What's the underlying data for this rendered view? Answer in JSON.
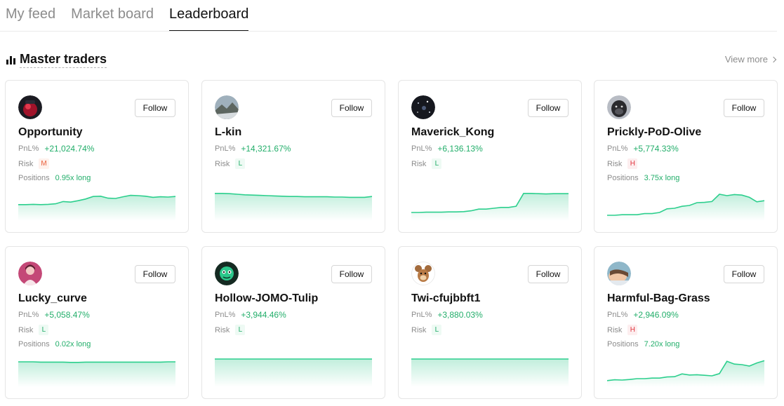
{
  "tabs": [
    {
      "label": "My feed",
      "active": false
    },
    {
      "label": "Market board",
      "active": false
    },
    {
      "label": "Leaderboard",
      "active": true
    }
  ],
  "section": {
    "title": "Master traders",
    "view_more": "View more"
  },
  "labels": {
    "follow": "Follow",
    "pnl": "PnL%",
    "risk": "Risk",
    "positions": "Positions"
  },
  "colors": {
    "accent_green": "#22ae6a",
    "risk_medium": "#e9603c",
    "risk_high": "#e0333c"
  },
  "traders": [
    {
      "name": "Opportunity",
      "pnl": "+21,024.74%",
      "risk": "M",
      "positions": "0.95x long",
      "avatar": "red-hooded-character-avatar",
      "trend": [
        0.38,
        0.38,
        0.39,
        0.38,
        0.39,
        0.41,
        0.49,
        0.47,
        0.52,
        0.58,
        0.67,
        0.68,
        0.61,
        0.6,
        0.66,
        0.71,
        0.7,
        0.68,
        0.64,
        0.66,
        0.65,
        0.67
      ]
    },
    {
      "name": "L-kin",
      "pnl": "+14,321.67%",
      "risk": "L",
      "positions": "",
      "avatar": "landscape-photo-avatar",
      "trend": [
        0.78,
        0.78,
        0.77,
        0.75,
        0.73,
        0.72,
        0.71,
        0.7,
        0.69,
        0.68,
        0.67,
        0.67,
        0.66,
        0.66,
        0.66,
        0.66,
        0.65,
        0.65,
        0.64,
        0.64,
        0.64,
        0.67
      ]
    },
    {
      "name": "Maverick_Kong",
      "pnl": "+6,136.13%",
      "risk": "L",
      "positions": "",
      "avatar": "galaxy-avatar",
      "trend": [
        0.1,
        0.1,
        0.11,
        0.11,
        0.11,
        0.12,
        0.12,
        0.13,
        0.16,
        0.22,
        0.22,
        0.25,
        0.28,
        0.28,
        0.32,
        0.78,
        0.78,
        0.77,
        0.76,
        0.77,
        0.77,
        0.77
      ]
    },
    {
      "name": "Prickly-PoD-Olive",
      "pnl": "+5,774.33%",
      "risk": "H",
      "positions": "3.75x long",
      "avatar": "gorilla-avatar",
      "trend": [
        0.0,
        0.0,
        0.02,
        0.02,
        0.02,
        0.06,
        0.06,
        0.1,
        0.23,
        0.25,
        0.32,
        0.35,
        0.45,
        0.46,
        0.49,
        0.75,
        0.7,
        0.74,
        0.72,
        0.64,
        0.48,
        0.52
      ]
    },
    {
      "name": "Lucky_curve",
      "pnl": "+5,058.47%",
      "risk": "L",
      "positions": "0.02x long",
      "avatar": "pink-portrait-avatar",
      "trend": [
        0.7,
        0.7,
        0.7,
        0.69,
        0.69,
        0.69,
        0.69,
        0.68,
        0.68,
        0.69,
        0.69,
        0.69,
        0.69,
        0.69,
        0.69,
        0.69,
        0.69,
        0.69,
        0.69,
        0.69,
        0.7,
        0.7
      ]
    },
    {
      "name": "Hollow-JOMO-Tulip",
      "pnl": "+3,944.46%",
      "risk": "L",
      "positions": "",
      "avatar": "neon-face-avatar",
      "trend": [
        0.8,
        0.8,
        0.8,
        0.8,
        0.8,
        0.8,
        0.8,
        0.8,
        0.8,
        0.8,
        0.8,
        0.8,
        0.8,
        0.8,
        0.8,
        0.8,
        0.8,
        0.8,
        0.8,
        0.8,
        0.8,
        0.8
      ]
    },
    {
      "name": "Twi-cfujbbft1",
      "pnl": "+3,880.03%",
      "risk": "L",
      "positions": "",
      "avatar": "cartoon-mouse-avatar",
      "trend": [
        0.8,
        0.8,
        0.8,
        0.8,
        0.8,
        0.8,
        0.8,
        0.8,
        0.8,
        0.8,
        0.8,
        0.8,
        0.8,
        0.8,
        0.8,
        0.8,
        0.8,
        0.8,
        0.8,
        0.8,
        0.8,
        0.8
      ]
    },
    {
      "name": "Harmful-Bag-Grass",
      "pnl": "+2,946.09%",
      "risk": "H",
      "positions": "7.20x long",
      "avatar": "sleeping-person-avatar",
      "trend": [
        0.03,
        0.06,
        0.05,
        0.07,
        0.1,
        0.1,
        0.12,
        0.12,
        0.16,
        0.17,
        0.27,
        0.23,
        0.24,
        0.22,
        0.2,
        0.28,
        0.72,
        0.62,
        0.6,
        0.55,
        0.66,
        0.74
      ]
    }
  ]
}
